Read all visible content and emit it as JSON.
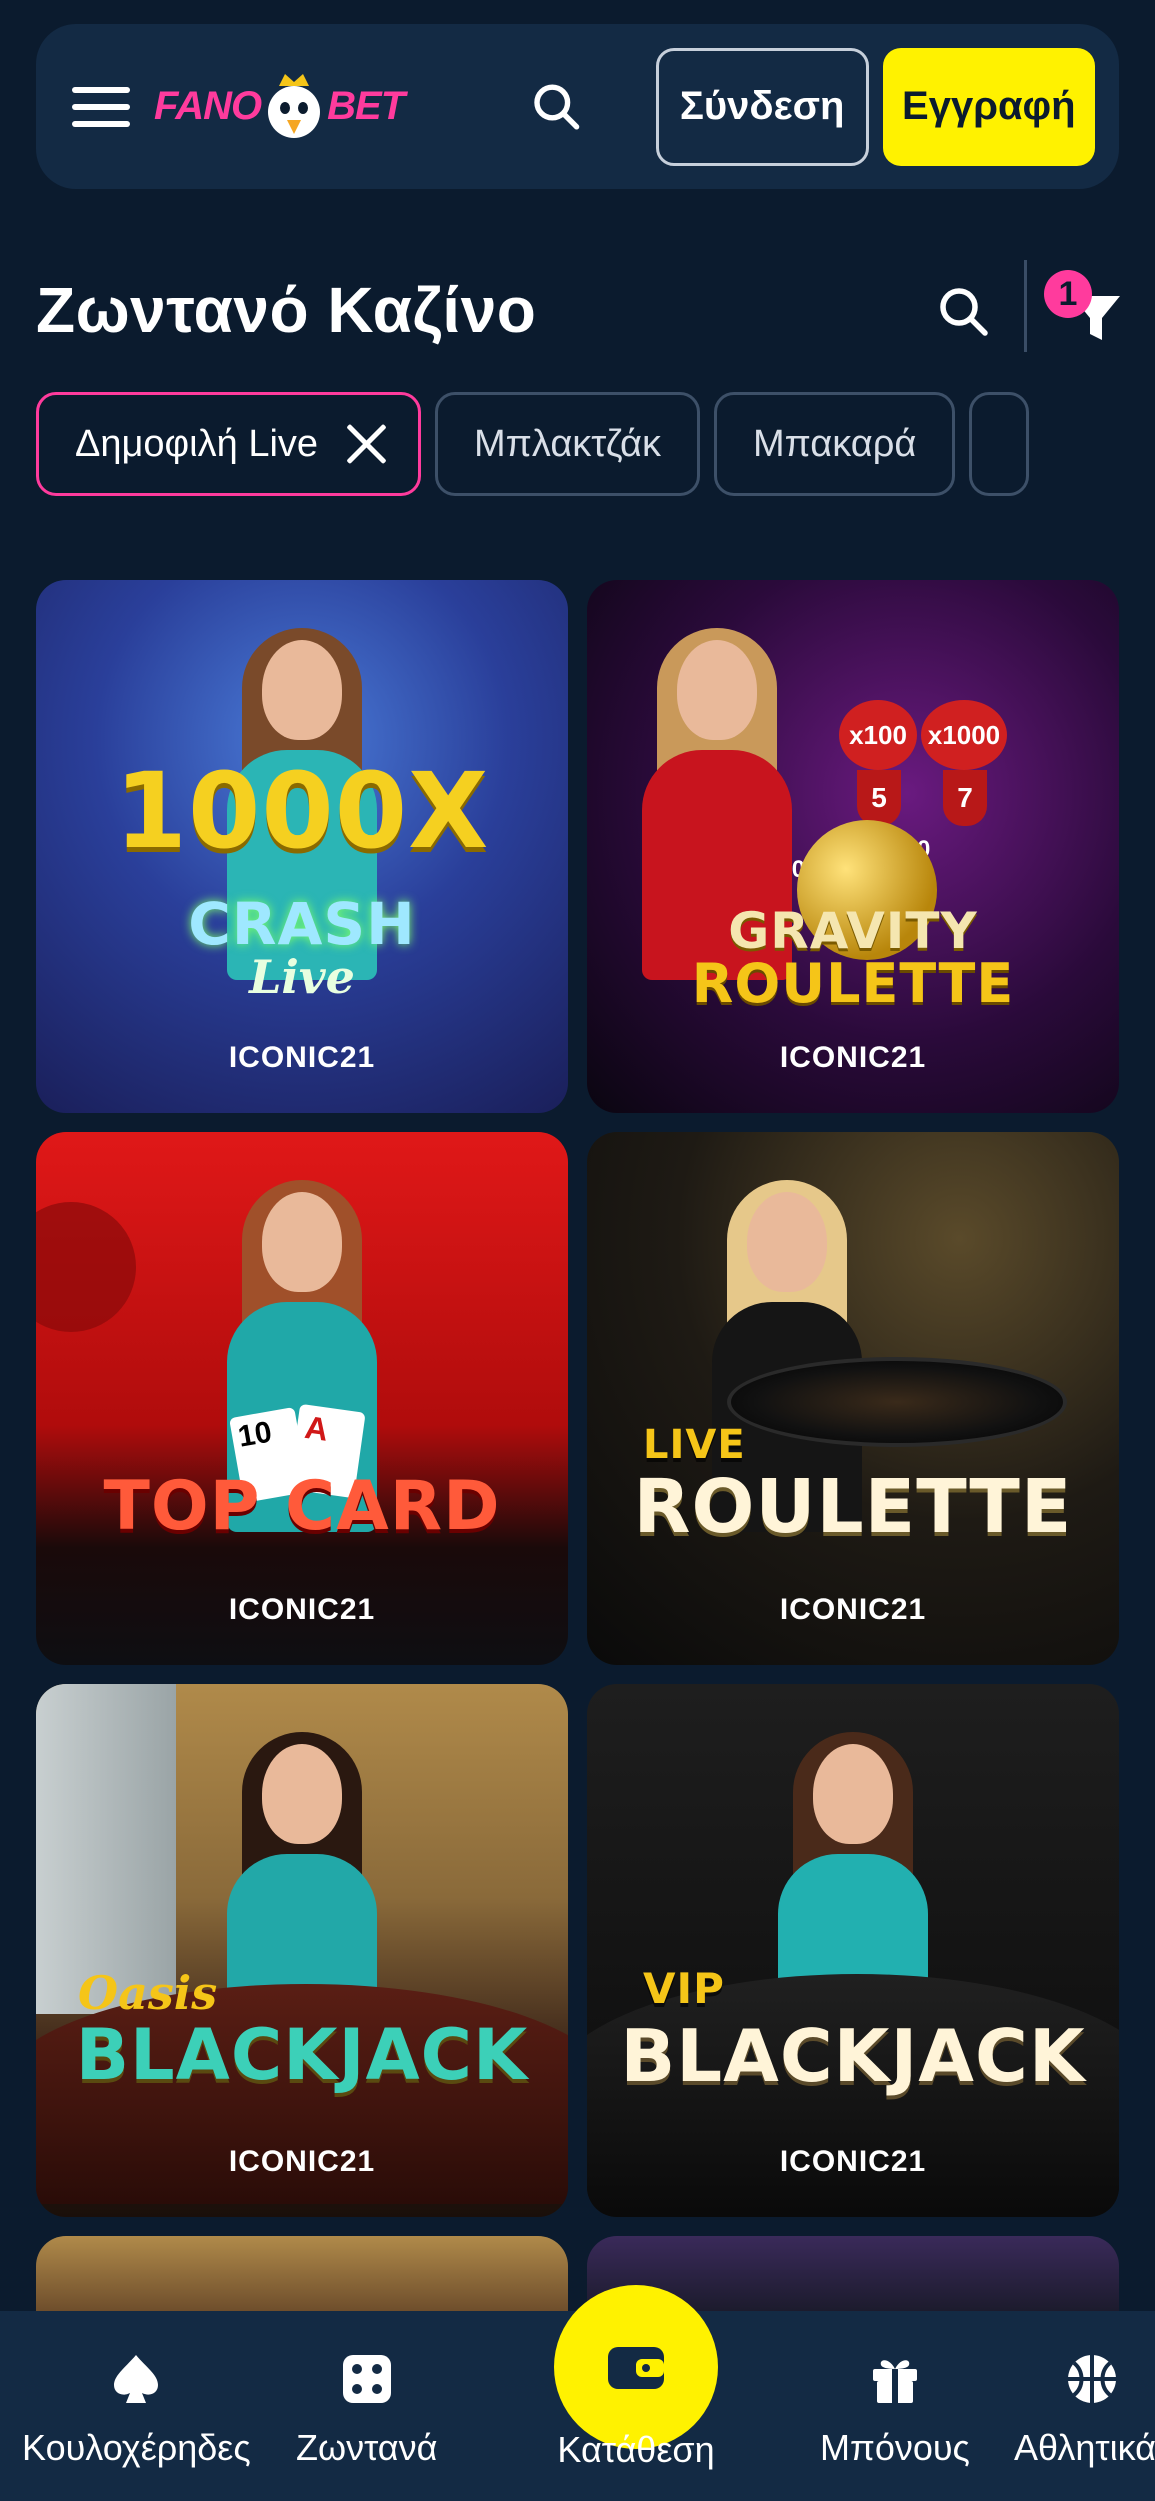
{
  "header": {
    "logo_left": "FANO",
    "logo_right": "BET",
    "login_label": "Σύνδεση",
    "register_label": "Εγγραφή"
  },
  "page": {
    "title": "Ζωντανό Καζίνο",
    "filter_count": "1"
  },
  "chips": [
    {
      "label": "Δημοφιλή Live",
      "active": true
    },
    {
      "label": "Μπλακτζάκ",
      "active": false
    },
    {
      "label": "Μπακαρά",
      "active": false
    }
  ],
  "games": [
    {
      "title": "CRASH",
      "subtitle": "Live",
      "badge": "1000X",
      "provider": "ICONIC21"
    },
    {
      "title": "GRAVITY",
      "subtitle": "ROULETTE",
      "provider": "ICONIC21",
      "multipliers": [
        "x100",
        "x1000",
        "5",
        "7",
        "x1000",
        "x500"
      ]
    },
    {
      "title": "TOP CARD",
      "provider": "ICONIC21"
    },
    {
      "title": "ROULETTE",
      "subtitle": "LIVE",
      "provider": "ICONIC21"
    },
    {
      "title": "BLACKJACK",
      "subtitle": "Oasis",
      "provider": "ICONIC21"
    },
    {
      "title": "BLACKJACK",
      "subtitle": "VIP",
      "provider": "ICONIC21"
    }
  ],
  "bottom_nav": [
    {
      "label": "Κουλοχέρηδες",
      "icon": "spade-icon"
    },
    {
      "label": "Ζωντανά",
      "icon": "dice-icon"
    },
    {
      "label": "Κατάθεση",
      "icon": "wallet-icon"
    },
    {
      "label": "Μπόνους",
      "icon": "gift-icon"
    },
    {
      "label": "Αθλητικά",
      "icon": "basketball-icon"
    }
  ],
  "colors": {
    "background": "#0b1b2e",
    "panel": "#132a44",
    "accent_yellow": "#fff200",
    "accent_pink": "#ff3b9d"
  }
}
